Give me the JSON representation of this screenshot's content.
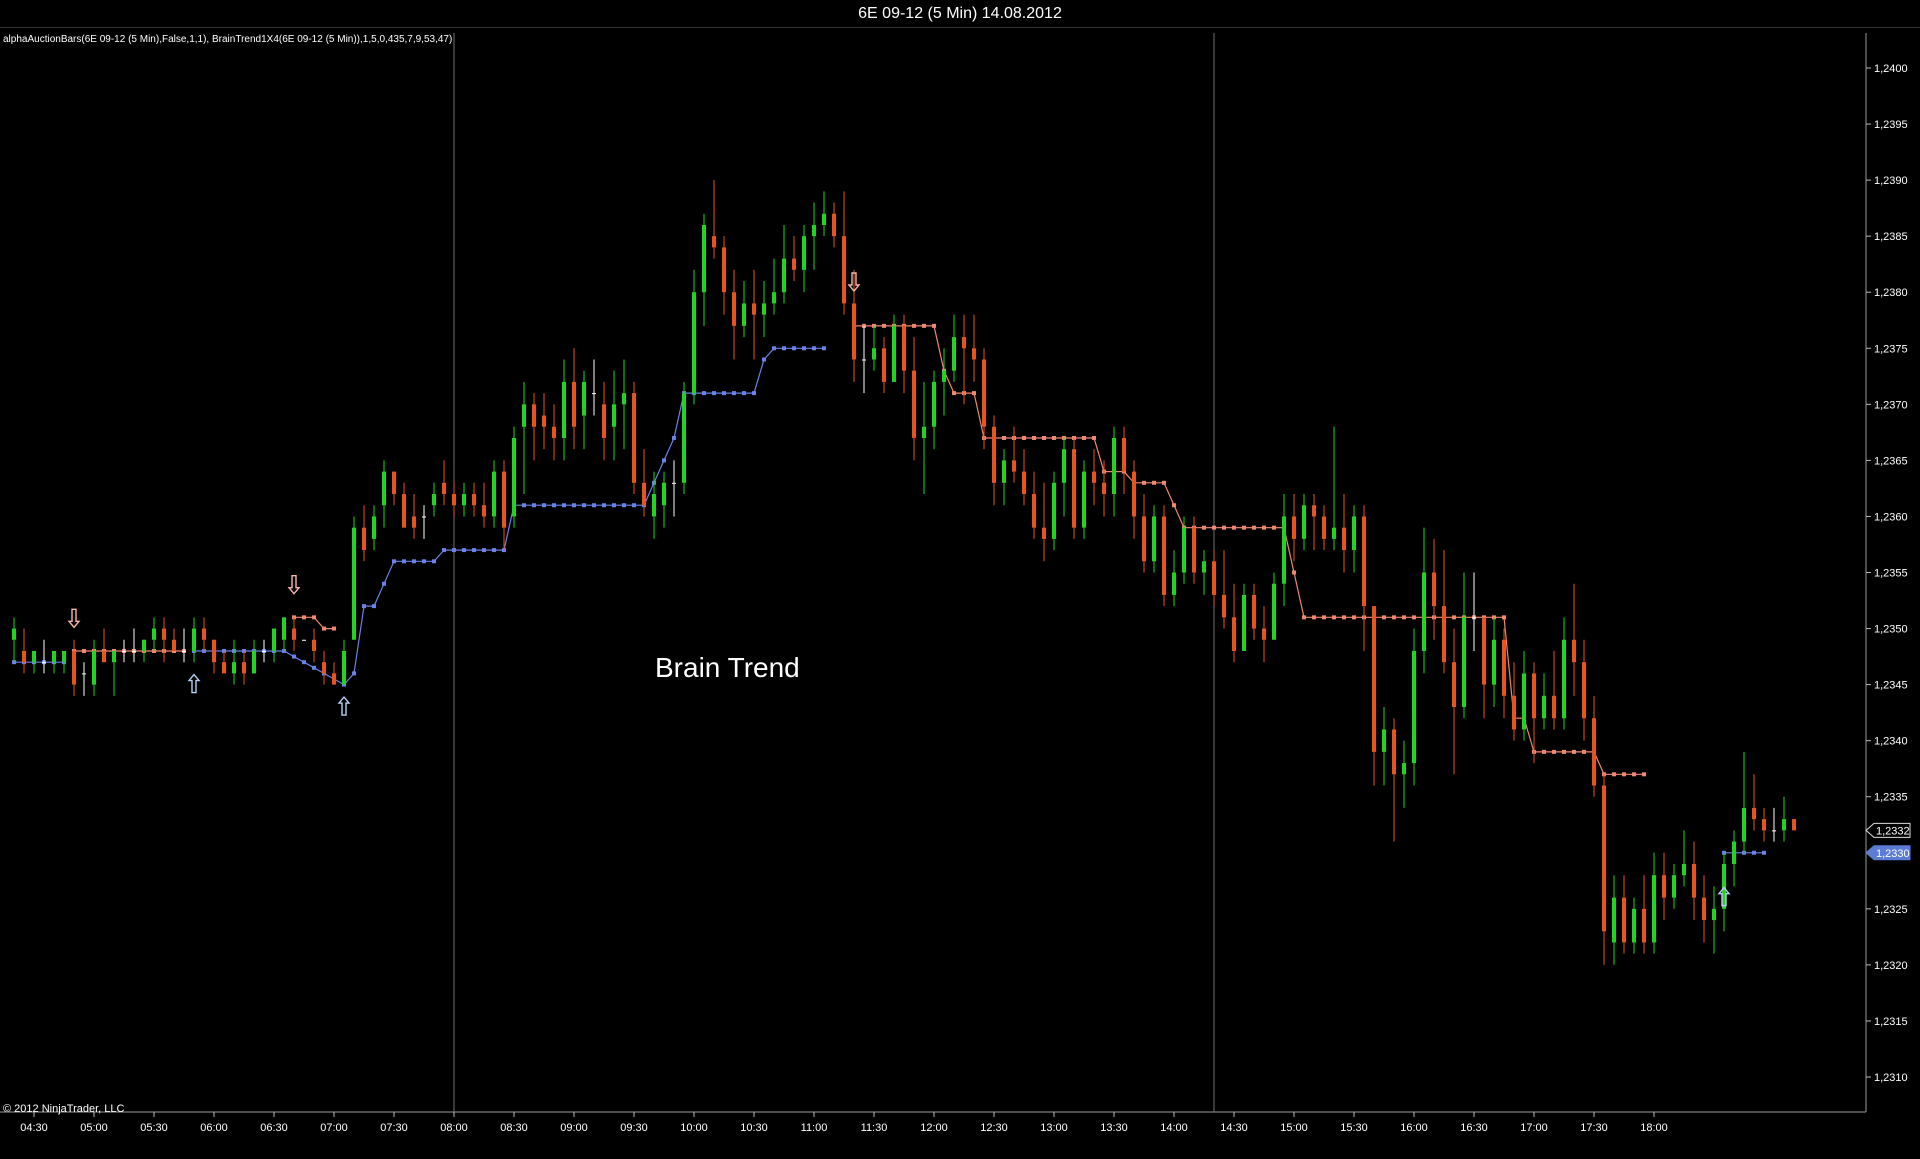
{
  "window": {
    "title": "6E 09-12 (5 Min)  14.08.2012"
  },
  "chart_data": {
    "type": "candlestick",
    "indicator_label": "alphaAuctionBars(6E 09-12 (5 Min),False,1,1), BrainTrend1X4(6E 09-12 (5 Min)),1,5,0,435,7,9,53,47)",
    "annotation": "Brain Trend",
    "copyright": "© 2012 NinjaTrader, LLC",
    "ylim": [
      1.2307,
      1.2404
    ],
    "y_ticks": [
      "1,2310",
      "1,2315",
      "1,2320",
      "1,2325",
      "1,2330",
      "1,2335",
      "1,2340",
      "1,2345",
      "1,2350",
      "1,2355",
      "1,2360",
      "1,2365",
      "1,2370",
      "1,2375",
      "1,2380",
      "1,2385",
      "1,2390",
      "1,2395",
      "1,2400"
    ],
    "x_ticks": [
      "04:30",
      "05:00",
      "05:30",
      "06:00",
      "06:30",
      "07:00",
      "07:30",
      "08:00",
      "08:30",
      "09:00",
      "09:30",
      "10:00",
      "10:30",
      "11:00",
      "11:30",
      "12:00",
      "12:30",
      "13:00",
      "13:30",
      "14:00",
      "14:30",
      "15:00",
      "15:30",
      "16:00",
      "16:30",
      "17:00",
      "17:30",
      "18:00"
    ],
    "start_time": "04:20",
    "bar_minutes": 5,
    "price_markers": [
      {
        "label": "1,2332",
        "value": 1.2332,
        "style": "outline"
      },
      {
        "label": "1,2330",
        "value": 1.233,
        "style": "filled"
      }
    ],
    "colors": {
      "bull": "#22d322",
      "bear": "#e85420",
      "doji": "#ffffff",
      "support": "#6a82e6",
      "resistance": "#ef8870",
      "marker_fill": "#5b7bd5"
    },
    "session_lines": [
      "08:00",
      "14:20"
    ],
    "candles": [
      [
        1.2349,
        1.2351,
        1.2347,
        1.235
      ],
      [
        1.2348,
        1.235,
        1.2346,
        1.2347
      ],
      [
        1.2347,
        1.2348,
        1.2346,
        1.2348
      ],
      [
        1.2347,
        1.2349,
        1.2346,
        1.2347
      ],
      [
        1.2347,
        1.2348,
        1.2346,
        1.2348
      ],
      [
        1.2347,
        1.2348,
        1.2346,
        1.2348
      ],
      [
        1.2348,
        1.2349,
        1.2344,
        1.2345
      ],
      [
        1.2346,
        1.2347,
        1.2344,
        1.2346
      ],
      [
        1.2345,
        1.2349,
        1.2344,
        1.2348
      ],
      [
        1.2348,
        1.235,
        1.2347,
        1.2347
      ],
      [
        1.2347,
        1.2348,
        1.2344,
        1.2348
      ],
      [
        1.2348,
        1.2349,
        1.2347,
        1.2348
      ],
      [
        1.2348,
        1.235,
        1.2347,
        1.2348
      ],
      [
        1.2348,
        1.2349,
        1.2347,
        1.2349
      ],
      [
        1.2349,
        1.2351,
        1.2348,
        1.235
      ],
      [
        1.235,
        1.2351,
        1.2347,
        1.2349
      ],
      [
        1.2349,
        1.235,
        1.2348,
        1.2348
      ],
      [
        1.2348,
        1.235,
        1.2347,
        1.2348
      ],
      [
        1.2348,
        1.2351,
        1.2347,
        1.235
      ],
      [
        1.235,
        1.2351,
        1.2348,
        1.2349
      ],
      [
        1.2349,
        1.2349,
        1.2346,
        1.2347
      ],
      [
        1.2347,
        1.2348,
        1.2346,
        1.2346
      ],
      [
        1.2346,
        1.2349,
        1.2345,
        1.2347
      ],
      [
        1.2347,
        1.2348,
        1.2345,
        1.2346
      ],
      [
        1.2346,
        1.2349,
        1.2346,
        1.2348
      ],
      [
        1.2348,
        1.2349,
        1.2347,
        1.2348
      ],
      [
        1.2348,
        1.235,
        1.2347,
        1.235
      ],
      [
        1.2349,
        1.2351,
        1.2348,
        1.2351
      ],
      [
        1.235,
        1.2351,
        1.2348,
        1.2349
      ],
      [
        1.2349,
        1.2349,
        1.2349,
        1.2349
      ],
      [
        1.2349,
        1.235,
        1.2347,
        1.2348
      ],
      [
        1.2347,
        1.2348,
        1.2345,
        1.2346
      ],
      [
        1.2346,
        1.2347,
        1.2345,
        1.2345
      ],
      [
        1.2345,
        1.2349,
        1.2345,
        1.2348
      ],
      [
        1.2349,
        1.236,
        1.2349,
        1.2359
      ],
      [
        1.2359,
        1.2361,
        1.2356,
        1.2357
      ],
      [
        1.2358,
        1.2361,
        1.2357,
        1.236
      ],
      [
        1.2361,
        1.2365,
        1.2359,
        1.2364
      ],
      [
        1.2364,
        1.2364,
        1.2361,
        1.2362
      ],
      [
        1.2362,
        1.2363,
        1.2359,
        1.2359
      ],
      [
        1.236,
        1.2362,
        1.2358,
        1.2359
      ],
      [
        1.236,
        1.2361,
        1.2358,
        1.236
      ],
      [
        1.2361,
        1.2363,
        1.236,
        1.2362
      ],
      [
        1.2363,
        1.2365,
        1.2361,
        1.2362
      ],
      [
        1.2362,
        1.2363,
        1.236,
        1.2361
      ],
      [
        1.2361,
        1.2363,
        1.236,
        1.2362
      ],
      [
        1.2362,
        1.2363,
        1.236,
        1.2361
      ],
      [
        1.2361,
        1.2363,
        1.2359,
        1.236
      ],
      [
        1.236,
        1.2365,
        1.2359,
        1.2364
      ],
      [
        1.2364,
        1.2365,
        1.2357,
        1.2359
      ],
      [
        1.236,
        1.2368,
        1.2359,
        1.2367
      ],
      [
        1.2368,
        1.2372,
        1.2362,
        1.237
      ],
      [
        1.237,
        1.2371,
        1.2365,
        1.2368
      ],
      [
        1.2369,
        1.2371,
        1.2366,
        1.2368
      ],
      [
        1.2368,
        1.237,
        1.2365,
        1.2367
      ],
      [
        1.2367,
        1.2374,
        1.2365,
        1.2372
      ],
      [
        1.2372,
        1.2375,
        1.2366,
        1.2368
      ],
      [
        1.2369,
        1.2373,
        1.2366,
        1.2372
      ],
      [
        1.2371,
        1.2374,
        1.2369,
        1.2371
      ],
      [
        1.237,
        1.2372,
        1.2365,
        1.2367
      ],
      [
        1.2368,
        1.2373,
        1.2365,
        1.237
      ],
      [
        1.237,
        1.2374,
        1.2366,
        1.2371
      ],
      [
        1.2371,
        1.2372,
        1.2362,
        1.2363
      ],
      [
        1.2363,
        1.2366,
        1.236,
        1.2361
      ],
      [
        1.236,
        1.2364,
        1.2358,
        1.2362
      ],
      [
        1.2361,
        1.2364,
        1.2359,
        1.2363
      ],
      [
        1.2363,
        1.2365,
        1.236,
        1.2363
      ],
      [
        1.2363,
        1.2372,
        1.2362,
        1.2371
      ],
      [
        1.2371,
        1.2382,
        1.237,
        1.238
      ],
      [
        1.238,
        1.2387,
        1.2377,
        1.2386
      ],
      [
        1.2385,
        1.239,
        1.2383,
        1.2384
      ],
      [
        1.2384,
        1.2385,
        1.2378,
        1.238
      ],
      [
        1.238,
        1.2382,
        1.2374,
        1.2377
      ],
      [
        1.2377,
        1.2381,
        1.2376,
        1.2379
      ],
      [
        1.2379,
        1.2382,
        1.2374,
        1.2378
      ],
      [
        1.2378,
        1.2381,
        1.2376,
        1.2379
      ],
      [
        1.2379,
        1.2383,
        1.2378,
        1.238
      ],
      [
        1.238,
        1.2386,
        1.2379,
        1.2383
      ],
      [
        1.2383,
        1.2385,
        1.2381,
        1.2382
      ],
      [
        1.2382,
        1.2386,
        1.238,
        1.2385
      ],
      [
        1.2385,
        1.2388,
        1.2382,
        1.2386
      ],
      [
        1.2386,
        1.2389,
        1.2385,
        1.2387
      ],
      [
        1.2387,
        1.2388,
        1.2384,
        1.2385
      ],
      [
        1.2385,
        1.2389,
        1.2378,
        1.2379
      ],
      [
        1.2379,
        1.2382,
        1.2372,
        1.2374
      ],
      [
        1.2374,
        1.2377,
        1.2371,
        1.2374
      ],
      [
        1.2374,
        1.2377,
        1.2373,
        1.2375
      ],
      [
        1.2375,
        1.2376,
        1.2371,
        1.2372
      ],
      [
        1.2372,
        1.2378,
        1.2372,
        1.2377
      ],
      [
        1.2377,
        1.2378,
        1.2371,
        1.2373
      ],
      [
        1.2373,
        1.2376,
        1.2365,
        1.2367
      ],
      [
        1.2367,
        1.2372,
        1.2362,
        1.2368
      ],
      [
        1.2368,
        1.2373,
        1.2366,
        1.2372
      ],
      [
        1.2372,
        1.2375,
        1.2369,
        1.2373
      ],
      [
        1.2373,
        1.2378,
        1.2372,
        1.2376
      ],
      [
        1.2376,
        1.2378,
        1.237,
        1.2375
      ],
      [
        1.2375,
        1.2378,
        1.2372,
        1.2374
      ],
      [
        1.2374,
        1.2375,
        1.2366,
        1.2368
      ],
      [
        1.2368,
        1.2369,
        1.2361,
        1.2363
      ],
      [
        1.2363,
        1.2366,
        1.2361,
        1.2365
      ],
      [
        1.2365,
        1.2368,
        1.2363,
        1.2364
      ],
      [
        1.2364,
        1.2366,
        1.2361,
        1.2362
      ],
      [
        1.2362,
        1.2364,
        1.2358,
        1.2359
      ],
      [
        1.2359,
        1.2363,
        1.2356,
        1.2358
      ],
      [
        1.2358,
        1.2364,
        1.2357,
        1.2363
      ],
      [
        1.2363,
        1.2367,
        1.236,
        1.2366
      ],
      [
        1.2366,
        1.2367,
        1.2358,
        1.2359
      ],
      [
        1.2359,
        1.2365,
        1.2358,
        1.2364
      ],
      [
        1.2364,
        1.2366,
        1.2361,
        1.2363
      ],
      [
        1.2363,
        1.2365,
        1.236,
        1.2362
      ],
      [
        1.2362,
        1.2368,
        1.236,
        1.2367
      ],
      [
        1.2367,
        1.2368,
        1.2362,
        1.2364
      ],
      [
        1.2364,
        1.2365,
        1.2358,
        1.236
      ],
      [
        1.236,
        1.2362,
        1.2355,
        1.2356
      ],
      [
        1.2356,
        1.2361,
        1.2355,
        1.236
      ],
      [
        1.236,
        1.2361,
        1.2352,
        1.2353
      ],
      [
        1.2353,
        1.2357,
        1.2352,
        1.2355
      ],
      [
        1.2355,
        1.236,
        1.2354,
        1.2359
      ],
      [
        1.2359,
        1.236,
        1.2354,
        1.2355
      ],
      [
        1.2355,
        1.2357,
        1.2353,
        1.2356
      ],
      [
        1.2356,
        1.2357,
        1.2352,
        1.2353
      ],
      [
        1.2353,
        1.2357,
        1.235,
        1.2351
      ],
      [
        1.2351,
        1.2354,
        1.2347,
        1.2348
      ],
      [
        1.2348,
        1.2354,
        1.2348,
        1.2353
      ],
      [
        1.2353,
        1.2354,
        1.2349,
        1.235
      ],
      [
        1.235,
        1.2352,
        1.2347,
        1.2349
      ],
      [
        1.2349,
        1.2355,
        1.2349,
        1.2354
      ],
      [
        1.2354,
        1.2362,
        1.2352,
        1.236
      ],
      [
        1.236,
        1.2362,
        1.2356,
        1.2358
      ],
      [
        1.2358,
        1.2362,
        1.2357,
        1.2361
      ],
      [
        1.2361,
        1.2362,
        1.2357,
        1.236
      ],
      [
        1.236,
        1.2361,
        1.2357,
        1.2358
      ],
      [
        1.2358,
        1.2368,
        1.2357,
        1.2359
      ],
      [
        1.2359,
        1.2362,
        1.2355,
        1.2357
      ],
      [
        1.2357,
        1.2361,
        1.2355,
        1.236
      ],
      [
        1.236,
        1.2361,
        1.2348,
        1.2352
      ],
      [
        1.2352,
        1.2352,
        1.2336,
        1.2339
      ],
      [
        1.2339,
        1.2343,
        1.2336,
        1.2341
      ],
      [
        1.2341,
        1.2342,
        1.2331,
        1.2337
      ],
      [
        1.2337,
        1.234,
        1.2334,
        1.2338
      ],
      [
        1.2338,
        1.235,
        1.2336,
        1.2348
      ],
      [
        1.2348,
        1.2359,
        1.2346,
        1.2355
      ],
      [
        1.2355,
        1.2358,
        1.2349,
        1.2352
      ],
      [
        1.2352,
        1.2357,
        1.2346,
        1.2347
      ],
      [
        1.2347,
        1.235,
        1.2337,
        1.2343
      ],
      [
        1.2343,
        1.2355,
        1.2342,
        1.2351
      ],
      [
        1.2351,
        1.2355,
        1.2348,
        1.2351
      ],
      [
        1.2351,
        1.2351,
        1.2342,
        1.2345
      ],
      [
        1.2345,
        1.2351,
        1.2343,
        1.2349
      ],
      [
        1.2349,
        1.235,
        1.2342,
        1.2344
      ],
      [
        1.2344,
        1.2347,
        1.234,
        1.2341
      ],
      [
        1.2341,
        1.2348,
        1.234,
        1.2346
      ],
      [
        1.2346,
        1.2347,
        1.2338,
        1.2342
      ],
      [
        1.2342,
        1.2346,
        1.2341,
        1.2344
      ],
      [
        1.2344,
        1.2348,
        1.2341,
        1.2342
      ],
      [
        1.2342,
        1.2351,
        1.2341,
        1.2349
      ],
      [
        1.2349,
        1.2354,
        1.2344,
        1.2347
      ],
      [
        1.2347,
        1.2349,
        1.234,
        1.2342
      ],
      [
        1.2342,
        1.2344,
        1.2335,
        1.2336
      ],
      [
        1.2336,
        1.2337,
        1.232,
        1.2323
      ],
      [
        1.2322,
        1.2328,
        1.232,
        1.2326
      ],
      [
        1.2326,
        1.2328,
        1.2321,
        1.2322
      ],
      [
        1.2322,
        1.2326,
        1.2321,
        1.2325
      ],
      [
        1.2325,
        1.2328,
        1.2321,
        1.2322
      ],
      [
        1.2322,
        1.233,
        1.2321,
        1.2328
      ],
      [
        1.2328,
        1.233,
        1.2324,
        1.2326
      ],
      [
        1.2326,
        1.2329,
        1.2325,
        1.2328
      ],
      [
        1.2328,
        1.2332,
        1.2327,
        1.2329
      ],
      [
        1.2329,
        1.2331,
        1.2324,
        1.2326
      ],
      [
        1.2326,
        1.2328,
        1.2322,
        1.2324
      ],
      [
        1.2324,
        1.2327,
        1.2321,
        1.2325
      ],
      [
        1.2325,
        1.233,
        1.2323,
        1.2329
      ],
      [
        1.2329,
        1.2332,
        1.2327,
        1.2331
      ],
      [
        1.2331,
        1.2339,
        1.233,
        1.2334
      ],
      [
        1.2334,
        1.2337,
        1.2332,
        1.2333
      ],
      [
        1.2333,
        1.2334,
        1.2331,
        1.2332
      ],
      [
        1.2332,
        1.2334,
        1.2331,
        1.2332
      ],
      [
        1.2332,
        1.2335,
        1.2331,
        1.2333
      ],
      [
        1.2333,
        1.2333,
        1.2332,
        1.2332
      ]
    ],
    "support": [
      [
        0,
        1.2347
      ],
      [
        5,
        1.2347
      ],
      [
        6,
        null
      ],
      [
        17,
        null
      ],
      [
        18,
        1.2348
      ],
      [
        27,
        1.2348
      ],
      [
        33,
        1.2345
      ],
      [
        34,
        1.2346
      ],
      [
        35,
        1.2352
      ],
      [
        36,
        1.2352
      ],
      [
        37,
        1.2354
      ],
      [
        38,
        1.2356
      ],
      [
        42,
        1.2356
      ],
      [
        43,
        1.2357
      ],
      [
        49,
        1.2357
      ],
      [
        50,
        1.2361
      ],
      [
        56,
        1.2361
      ],
      [
        57,
        1.2361
      ],
      [
        62,
        1.2361
      ],
      [
        63,
        1.2361
      ],
      [
        66,
        1.2367
      ],
      [
        67,
        1.2371
      ],
      [
        74,
        1.2371
      ],
      [
        75,
        1.2374
      ],
      [
        76,
        1.2375
      ],
      [
        81,
        1.2375
      ],
      [
        82,
        null
      ],
      [
        170,
        null
      ],
      [
        171,
        1.233
      ],
      [
        175,
        1.233
      ]
    ],
    "resistance": [
      [
        5,
        null
      ],
      [
        6,
        1.2348
      ],
      [
        17,
        1.2348
      ],
      [
        18,
        null
      ],
      [
        27,
        null
      ],
      [
        28,
        1.2351
      ],
      [
        30,
        1.2351
      ],
      [
        31,
        1.235
      ],
      [
        32,
        1.235
      ],
      [
        33,
        null
      ],
      [
        83,
        null
      ],
      [
        84,
        1.2377
      ],
      [
        92,
        1.2377
      ],
      [
        93,
        1.2373
      ],
      [
        94,
        1.2371
      ],
      [
        96,
        1.2371
      ],
      [
        97,
        1.2367
      ],
      [
        108,
        1.2367
      ],
      [
        109,
        1.2364
      ],
      [
        111,
        1.2364
      ],
      [
        112,
        1.2363
      ],
      [
        115,
        1.2363
      ],
      [
        117,
        1.2359
      ],
      [
        127,
        1.2359
      ],
      [
        128,
        1.2355
      ],
      [
        129,
        1.2351
      ],
      [
        149,
        1.2351
      ],
      [
        150,
        1.2342
      ],
      [
        151,
        1.2342
      ],
      [
        152,
        1.2339
      ],
      [
        158,
        1.2339
      ],
      [
        159,
        1.2337
      ],
      [
        163,
        1.2337
      ],
      [
        164,
        null
      ]
    ],
    "up_arrows": [
      [
        18,
        1.2345
      ],
      [
        33,
        1.2343
      ],
      [
        171,
        1.2326
      ]
    ],
    "down_arrows": [
      [
        6,
        1.2351
      ],
      [
        28,
        1.2354
      ],
      [
        84,
        1.2381
      ]
    ]
  }
}
